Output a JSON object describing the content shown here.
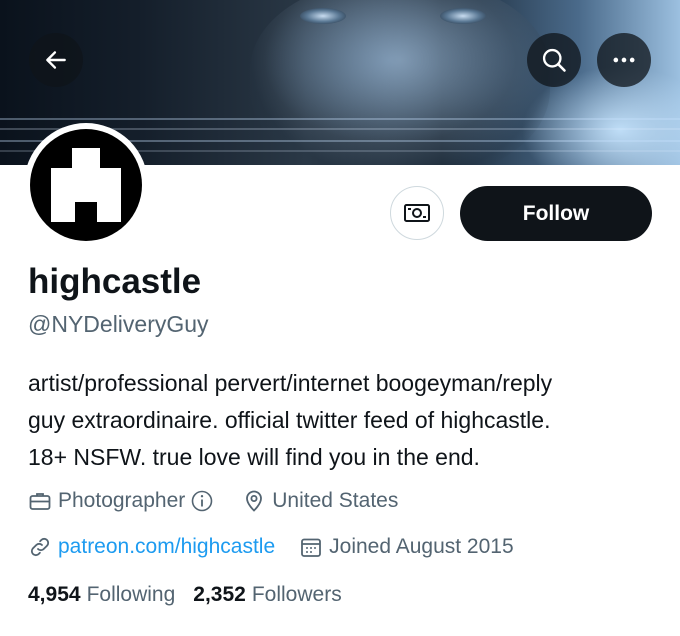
{
  "profile": {
    "display_name": "highcastle",
    "handle": "@NYDeliveryGuy",
    "bio_lines": [
      "artist/professional pervert/internet boogeyman/reply",
      "guy extraordinaire. official twitter feed of highcastle.",
      "18+ NSFW. true love will find you in the end."
    ],
    "category": "Photographer",
    "location": "United States",
    "website": "patreon.com/highcastle",
    "joined": "Joined August 2015"
  },
  "actions": {
    "follow_label": "Follow"
  },
  "stats": {
    "following_count": "4,954",
    "following_label": "Following",
    "followers_count": "2,352",
    "followers_label": "Followers"
  },
  "icons": {
    "back": "back-arrow-icon",
    "search": "search-icon",
    "more": "more-icon",
    "tip": "tip-jar-icon",
    "category": "briefcase-icon",
    "info": "info-icon",
    "location": "location-pin-icon",
    "link": "link-icon",
    "calendar": "calendar-icon"
  },
  "colors": {
    "text_primary": "#0f1419",
    "text_secondary": "#536471",
    "link": "#1d9bf0",
    "follow_button_bg": "#0f1419"
  }
}
